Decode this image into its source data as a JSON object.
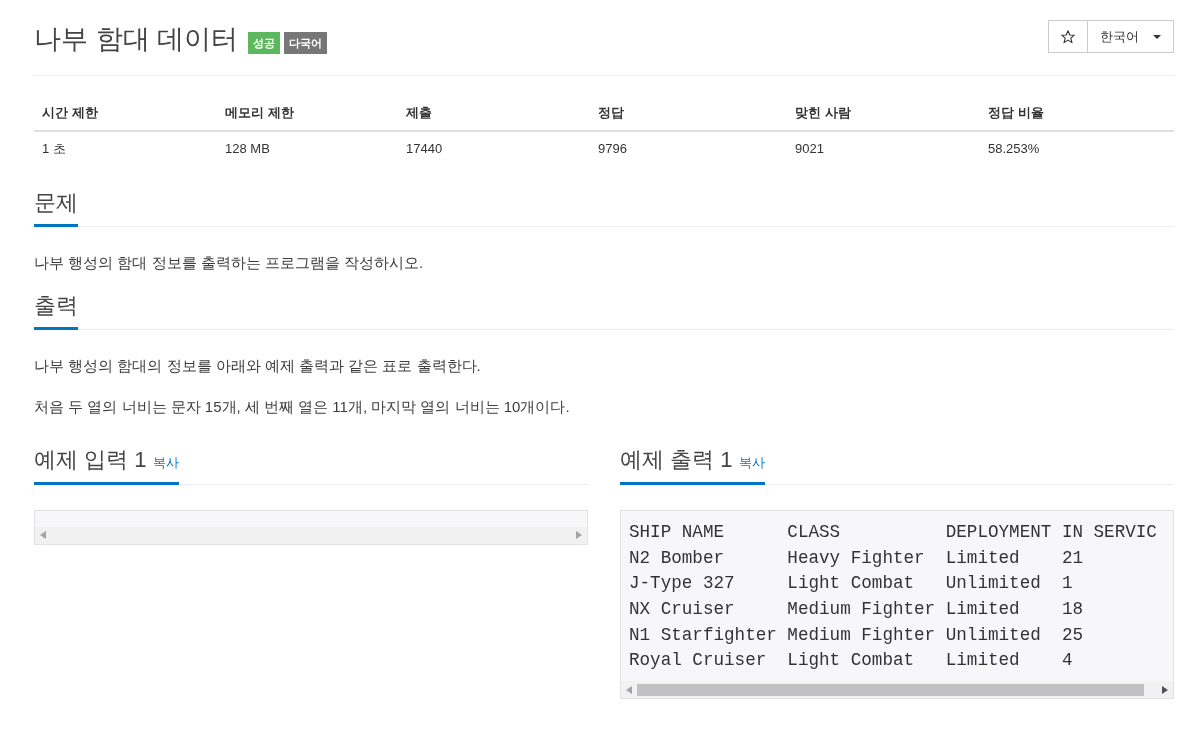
{
  "problem": {
    "title": "나부 함대 데이터",
    "labels": [
      {
        "text": "성공",
        "color": "#5cb85c"
      },
      {
        "text": "다국어",
        "color": "#777777"
      }
    ]
  },
  "toolbar": {
    "language": "한국어"
  },
  "stats": {
    "columns": [
      "시간 제한",
      "메모리 제한",
      "제출",
      "정답",
      "맞힌 사람",
      "정답 비율"
    ],
    "rows": [
      [
        "1 초",
        "128 MB",
        "17440",
        "9796",
        "9021",
        "58.253%"
      ]
    ]
  },
  "sections": [
    {
      "heading": "문제",
      "paragraphs": [
        "나부 행성의 함대 정보를 출력하는 프로그램을 작성하시오."
      ]
    },
    {
      "heading": "출력",
      "paragraphs": [
        "나부 행성의 함대의 정보를 아래와 예제 출력과 같은 표로 출력한다.",
        "처음 두 열의 너비는 문자 15개, 세 번째 열은 11개, 마지막 열의 너비는 10개이다."
      ]
    }
  ],
  "samples": [
    {
      "heading": "예제 입력 1",
      "copy_link": "복사"
    },
    {
      "heading": "예제 출력 1",
      "copy_link": "복사",
      "lines": [
        "SHIP NAME      CLASS          DEPLOYMENT IN SERVIC",
        "N2 Bomber      Heavy Fighter  Limited    21",
        "J-Type 327     Light Combat   Unlimited  1",
        "NX Cruiser     Medium Fighter Limited    18",
        "N1 Starfighter Medium Fighter Unlimited  25",
        "Royal Cruiser  Light Combat   Limited    4"
      ]
    }
  ]
}
